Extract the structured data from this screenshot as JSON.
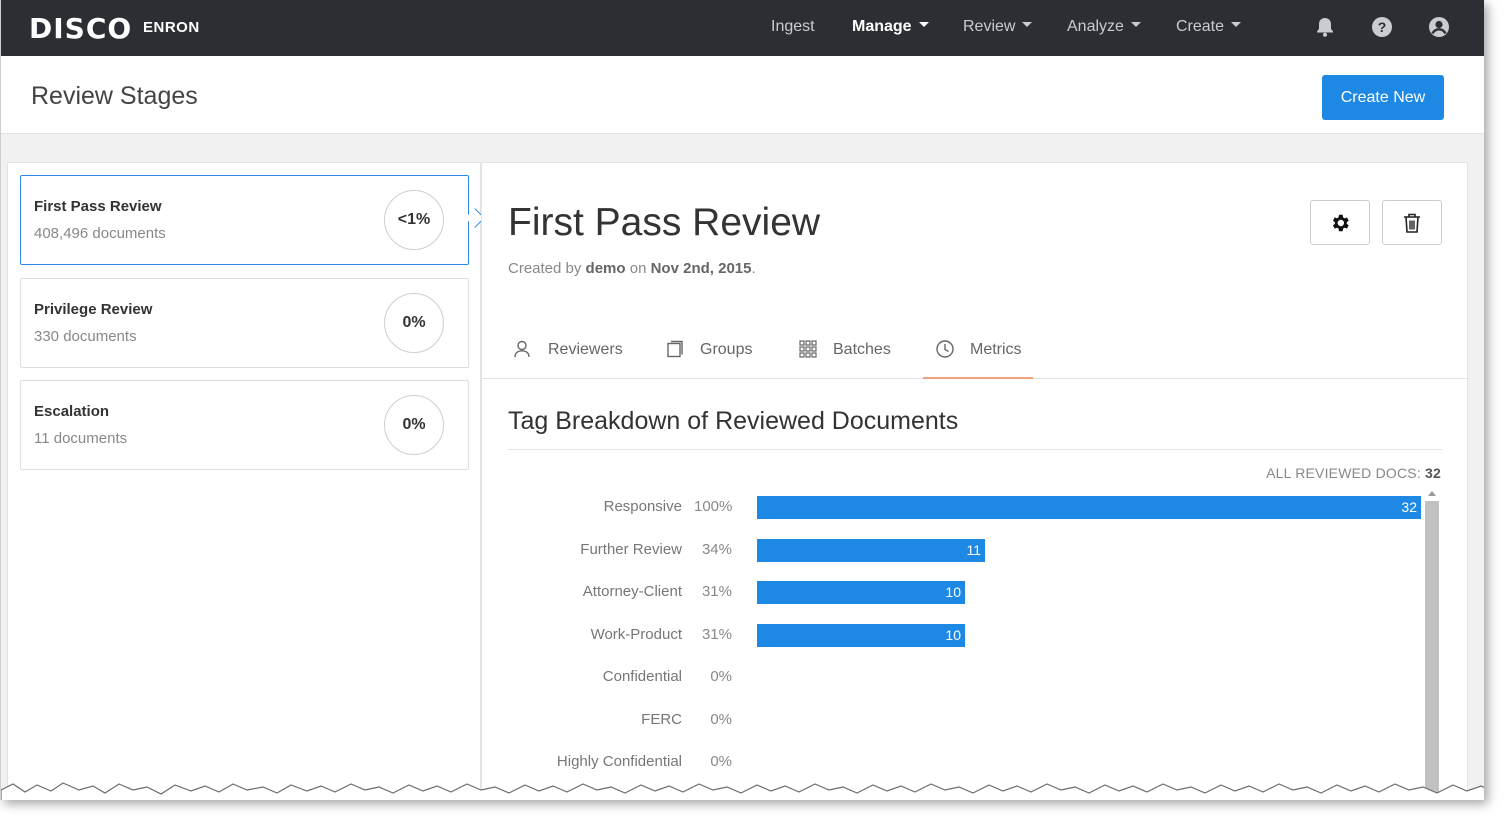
{
  "app": {
    "logo": "DISCO",
    "client": "ENRON"
  },
  "nav": {
    "ingest": "Ingest",
    "manage": "Manage",
    "review": "Review",
    "analyze": "Analyze",
    "create": "Create"
  },
  "icons": {
    "notifications": "bell-icon",
    "help": "help-icon",
    "account": "user-account-icon"
  },
  "header": {
    "title": "Review Stages",
    "create_button": "Create New"
  },
  "stages": [
    {
      "name": "First Pass Review",
      "count": "408,496 documents",
      "percent": "<1%",
      "selected": true
    },
    {
      "name": "Privilege Review",
      "count": "330 documents",
      "percent": "0%",
      "selected": false
    },
    {
      "name": "Escalation",
      "count": "11 documents",
      "percent": "0%",
      "selected": false
    }
  ],
  "detail": {
    "title": "First Pass Review",
    "created_prefix": "Created by",
    "created_by": "demo",
    "created_on": "on",
    "created_date": "Nov 2nd, 2015",
    "created_suffix": "."
  },
  "tabs": {
    "reviewers": "Reviewers",
    "groups": "Groups",
    "batches": "Batches",
    "metrics": "Metrics",
    "active": "Metrics"
  },
  "metrics": {
    "section_title": "Tag Breakdown of Reviewed Documents",
    "all_docs_label": "ALL REVIEWED DOCS:",
    "all_docs_value": "32"
  },
  "colors": {
    "accent": "#1e88e5",
    "topbar": "#2b2f33",
    "tab_underline": "#f0a07a"
  },
  "chart_data": {
    "type": "bar",
    "orientation": "horizontal",
    "title": "Tag Breakdown of Reviewed Documents",
    "categories": [
      "Responsive",
      "Further Review",
      "Attorney-Client",
      "Work-Product",
      "Confidential",
      "FERC",
      "Highly Confidential"
    ],
    "percent_labels": [
      "100%",
      "34%",
      "31%",
      "31%",
      "0%",
      "0%",
      "0%"
    ],
    "values": [
      32,
      11,
      10,
      10,
      0,
      0,
      0
    ],
    "xlim": [
      0,
      32
    ],
    "grid": false
  }
}
